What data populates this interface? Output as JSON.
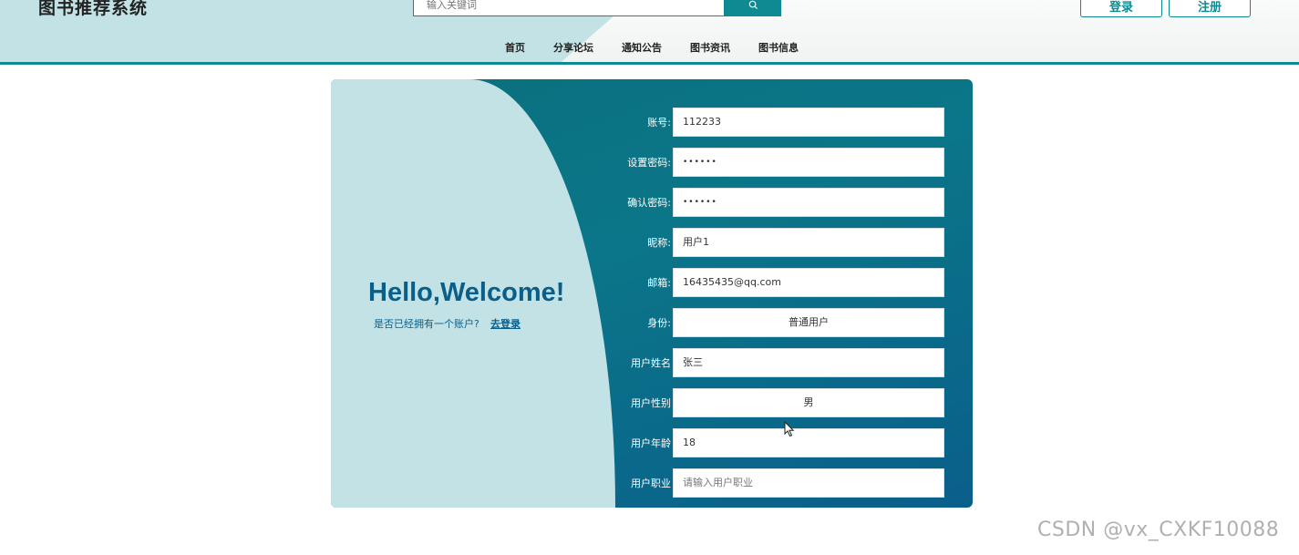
{
  "header": {
    "site_title": "图书推荐系统",
    "search_placeholder": "输入关键词",
    "search_icon": "search-icon",
    "login_label": "登录",
    "register_label": "注册",
    "nav": [
      "首页",
      "分享论坛",
      "通知公告",
      "图书资讯",
      "图书信息"
    ]
  },
  "welcome": {
    "title": "Hello,Welcome!",
    "question": "是否已经拥有一个账户?",
    "login_link": "去登录"
  },
  "form": {
    "account": {
      "label": "账号:",
      "value": "112233"
    },
    "password": {
      "label": "设置密码:",
      "value": "••••••"
    },
    "confirm": {
      "label": "确认密码:",
      "value": "••••••"
    },
    "nickname": {
      "label": "昵称:",
      "value": "用户1"
    },
    "email": {
      "label": "邮箱:",
      "value": "16435435@qq.com"
    },
    "identity": {
      "label": "身份:",
      "value": "普通用户"
    },
    "name": {
      "label": "用户姓名",
      "value": "张三"
    },
    "gender": {
      "label": "用户性别",
      "value": "男"
    },
    "age": {
      "label": "用户年龄",
      "value": "18"
    },
    "job": {
      "label": "用户职业",
      "placeholder": "请输入用户职业"
    }
  },
  "watermark": "CSDN @vx_CXKF10088",
  "colors": {
    "accent": "#0f8a92",
    "panel_light": "#c3e2e6",
    "panel_dark": "#0a6f7d",
    "welcome_text": "#0a5f8a"
  }
}
